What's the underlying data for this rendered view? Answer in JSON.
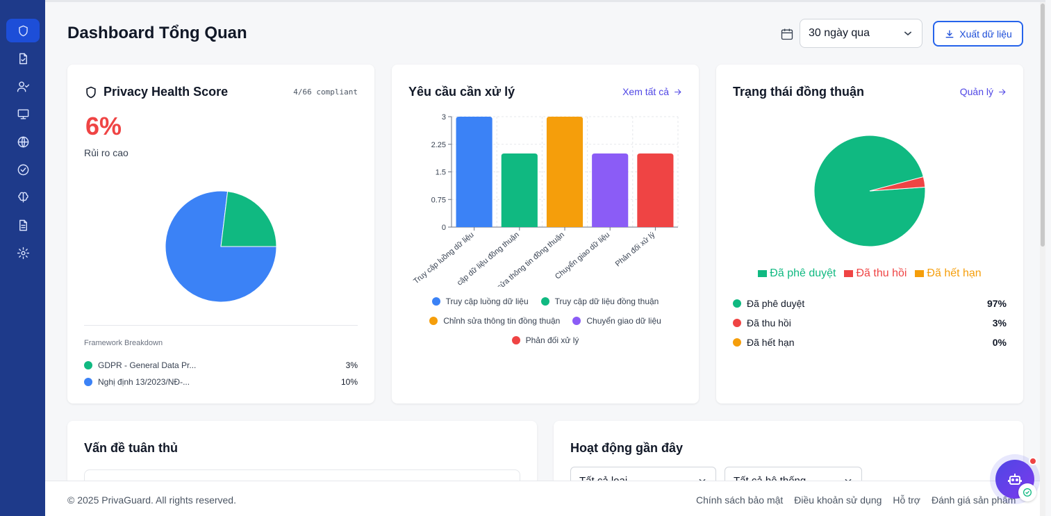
{
  "sidebar": {
    "items": [
      {
        "icon": "shield-icon",
        "active": true
      },
      {
        "icon": "file-check-icon"
      },
      {
        "icon": "user-check-icon"
      },
      {
        "icon": "monitor-icon"
      },
      {
        "icon": "globe-icon"
      },
      {
        "icon": "check-circle-icon"
      },
      {
        "icon": "brain-icon"
      },
      {
        "icon": "document-icon"
      },
      {
        "icon": "gear-icon"
      }
    ]
  },
  "header": {
    "title": "Dashboard Tổng Quan",
    "range": "30 ngày qua",
    "export_label": "Xuất dữ liệu"
  },
  "health": {
    "title": "Privacy Health Score",
    "compliant": "4/66 compliant",
    "score": "6%",
    "risk_label": "Rủi ro cao",
    "breakdown_title": "Framework Breakdown",
    "frameworks": [
      {
        "name": "GDPR - General Data Pr...",
        "pct": "3%",
        "color": "#10b981"
      },
      {
        "name": "Nghị định 13/2023/NĐ-...",
        "pct": "10%",
        "color": "#3b82f6"
      }
    ]
  },
  "requests": {
    "title": "Yêu cầu cần xử lý",
    "link": "Xem tất cả"
  },
  "consent": {
    "title": "Trạng thái đồng thuận",
    "link": "Quản lý",
    "legend": [
      {
        "label": "Đã phê duyệt",
        "color": "#10b981"
      },
      {
        "label": "Đã thu hồi",
        "color": "#ef4444"
      },
      {
        "label": "Đã hết hạn",
        "color": "#f59e0b"
      }
    ],
    "stats": [
      {
        "label": "Đã phê duyệt",
        "pct": "97%",
        "color": "#10b981"
      },
      {
        "label": "Đã thu hồi",
        "pct": "3%",
        "color": "#ef4444"
      },
      {
        "label": "Đã hết hạn",
        "pct": "0%",
        "color": "#f59e0b"
      }
    ]
  },
  "issues": {
    "title": "Vấn đề tuân thủ"
  },
  "activity": {
    "title": "Hoạt động gần đây",
    "filter_type": "Tất cả loại",
    "filter_system": "Tất cả hệ thống"
  },
  "footer": {
    "copyright": "© 2025 PrivaGuard. All rights reserved.",
    "links": [
      "Chính sách bảo mật",
      "Điều khoản sử dụng",
      "Hỗ trợ",
      "Đánh giá sản phẩm"
    ]
  },
  "chart_data": [
    {
      "type": "pie",
      "slices": [
        {
          "label": "Nghị định 13/2023/NĐ-...",
          "value": 10,
          "color": "#3b82f6"
        },
        {
          "label": "GDPR - General Data Pr...",
          "value": 3,
          "color": "#10b981"
        }
      ]
    },
    {
      "type": "bar",
      "categories": [
        "Truy cập luồng dữ liệu",
        "Truy cập dữ liệu đồng thuận",
        "Chỉnh sửa thông tin đồng thuận",
        "Chuyển giao dữ liệu",
        "Phản đối xử lý"
      ],
      "tick_labels": [
        "Truy cập luồng dữ liệu",
        "cập dữ liệu đồng thuận",
        "sửa thông tin đồng thuận",
        "Chuyển giao dữ liệu",
        "Phản đối xử lý"
      ],
      "values": [
        3,
        2,
        3,
        2,
        2
      ],
      "colors": [
        "#3b82f6",
        "#10b981",
        "#f59e0b",
        "#8b5cf6",
        "#ef4444"
      ],
      "yticks": [
        "0",
        "0.75",
        "1.5",
        "2.25",
        "3"
      ],
      "ylim": [
        0,
        3
      ],
      "grid": true,
      "legend": "bottom"
    },
    {
      "type": "pie",
      "slices": [
        {
          "label": "Đã phê duyệt",
          "value": 97,
          "color": "#10b981"
        },
        {
          "label": "Đã thu hồi",
          "value": 3,
          "color": "#ef4444"
        },
        {
          "label": "Đã hết hạn",
          "value": 0,
          "color": "#f59e0b"
        }
      ],
      "legend": "bottom"
    }
  ]
}
